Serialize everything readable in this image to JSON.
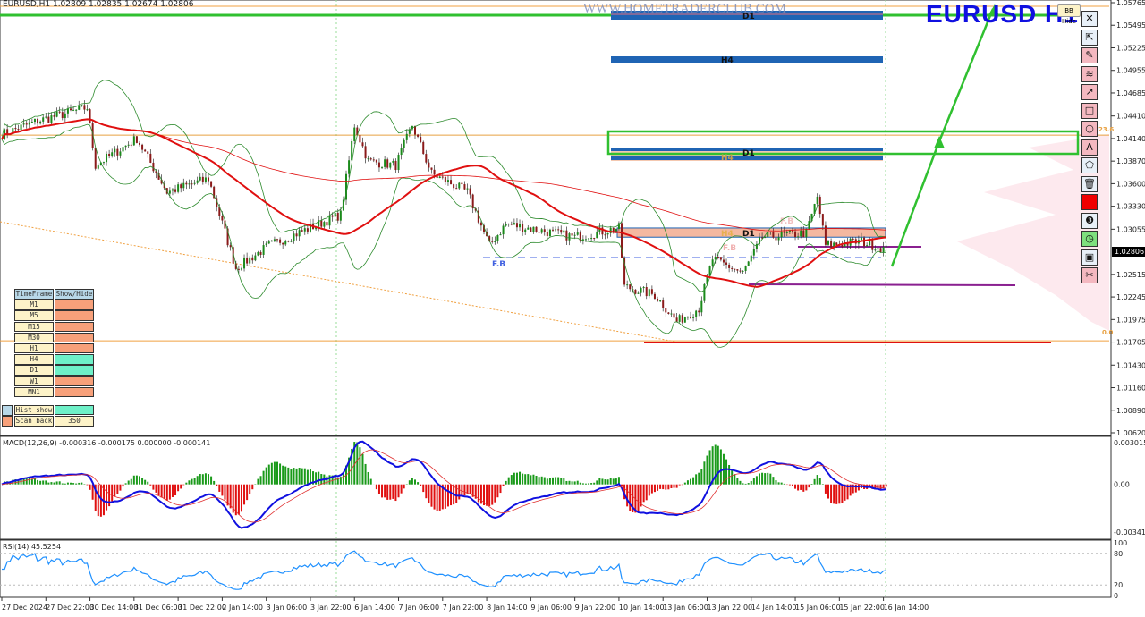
{
  "header": {
    "symbol_info": "EURUSD,H1  1.02809 1.02835 1.02674 1.02806",
    "title": "EURUSD  H1",
    "watermark": "WWW.HOMETRADERCLUB.COM",
    "bb_hide": "BB Hide",
    "current_price": "1.02806"
  },
  "toolbar": [
    {
      "icon": "close-icon",
      "glyph": "✕"
    },
    {
      "icon": "cursor-icon",
      "glyph": "⇱"
    },
    {
      "icon": "pencil-icon",
      "glyph": "✎"
    },
    {
      "icon": "wave-icon",
      "glyph": "≋"
    },
    {
      "icon": "arrow-icon",
      "glyph": "↗"
    },
    {
      "icon": "rectangle-icon",
      "glyph": "□"
    },
    {
      "icon": "circle-icon",
      "glyph": "○"
    },
    {
      "icon": "text-icon",
      "glyph": "A"
    },
    {
      "icon": "fill-icon",
      "glyph": "⬠"
    },
    {
      "icon": "trash-icon",
      "glyph": "🗑"
    },
    {
      "icon": "color-icon",
      "glyph": ""
    },
    {
      "icon": "number-icon",
      "glyph": "❸"
    },
    {
      "icon": "clock-icon",
      "glyph": "◷"
    },
    {
      "icon": "save-icon",
      "glyph": "▣"
    },
    {
      "icon": "scissors-icon",
      "glyph": "✂"
    }
  ],
  "colors": {
    "accent": "#1010e0",
    "bull": "#1a8a1a",
    "bear": "#8b1a1a",
    "ma": "#e01010",
    "bb": "#2e8b2e",
    "zone": "#f4b8a0",
    "zone_border": "#1f64b4"
  },
  "timeframe_table": {
    "headers": [
      "TimeFrame",
      "Show/Hide"
    ],
    "rows": [
      {
        "tf": "M1",
        "on": false
      },
      {
        "tf": "M5",
        "on": false
      },
      {
        "tf": "M15",
        "on": false
      },
      {
        "tf": "M30",
        "on": false
      },
      {
        "tf": "H1",
        "on": false
      },
      {
        "tf": "H4",
        "on": true
      },
      {
        "tf": "D1",
        "on": true
      },
      {
        "tf": "W1",
        "on": false
      },
      {
        "tf": "MN1",
        "on": false
      }
    ],
    "hist_show": "Hist show",
    "scan_back": "Scan back",
    "scan_back_value": "350"
  },
  "zone_labels": {
    "d1_top": "D1",
    "h4_top": "H4",
    "d1_mid": "D1",
    "h4_mid": "H4",
    "d1_low": "D1",
    "h4_low": "H4",
    "fb1": "F.B",
    "fb2": "F.B",
    "fb3": "F.B",
    "fib_236": "23.6",
    "fib_0": "0.0"
  },
  "chart_data": {
    "type": "candlestick",
    "symbol": "EURUSD",
    "timeframe": "H1",
    "y_ticks": [
      "1.05765",
      "1.05495",
      "1.05225",
      "1.04955",
      "1.04685",
      "1.04410",
      "1.04140",
      "1.03870",
      "1.03600",
      "1.03330",
      "1.03055",
      "1.02515",
      "1.02245",
      "1.01975",
      "1.01705",
      "1.01430",
      "1.01160",
      "1.00890",
      "1.00620"
    ],
    "ylim": [
      1.0062,
      1.05765
    ],
    "x_ticks": [
      "27 Dec 2024",
      "27 Dec 22:00",
      "30 Dec 14:00",
      "31 Dec 06:00",
      "31 Dec 22:00",
      "2 Jan 14:00",
      "3 Jan 06:00",
      "3 Jan 22:00",
      "6 Jan 14:00",
      "7 Jan 06:00",
      "7 Jan 22:00",
      "8 Jan 14:00",
      "9 Jan 06:00",
      "9 Jan 22:00",
      "10 Jan 14:00",
      "13 Jan 06:00",
      "13 Jan 22:00",
      "14 Jan 14:00",
      "15 Jan 06:00",
      "15 Jan 22:00",
      "16 Jan 14:00"
    ],
    "bars_per_tick": 16,
    "close_path": [
      [
        0,
        1.0419
      ],
      [
        13,
        1.0435
      ],
      [
        31,
        1.0451
      ],
      [
        34,
        1.0382
      ],
      [
        49,
        1.0414
      ],
      [
        60,
        1.035
      ],
      [
        75,
        1.0366
      ],
      [
        85,
        1.0259
      ],
      [
        97,
        1.0286
      ],
      [
        123,
        1.0323
      ],
      [
        128,
        1.043
      ],
      [
        133,
        1.0387
      ],
      [
        143,
        1.0382
      ],
      [
        149,
        1.043
      ],
      [
        156,
        1.0372
      ],
      [
        169,
        1.035
      ],
      [
        177,
        1.0286
      ],
      [
        183,
        1.0312
      ],
      [
        208,
        1.0296
      ],
      [
        224,
        1.0307
      ],
      [
        226,
        1.0237
      ],
      [
        237,
        1.0227
      ],
      [
        245,
        1.0195
      ],
      [
        253,
        1.0211
      ],
      [
        258,
        1.027
      ],
      [
        269,
        1.0253
      ],
      [
        276,
        1.0296
      ],
      [
        292,
        1.0301
      ],
      [
        296,
        1.0344
      ],
      [
        299,
        1.0286
      ],
      [
        312,
        1.0291
      ],
      [
        321,
        1.0281
      ]
    ],
    "levels": {
      "green_zone": [
        1.0391,
        1.0418
      ],
      "d1_top": 1.0566,
      "h4_top": 1.0509,
      "zone_mid": [
        1.0296,
        1.0307
      ],
      "fib_236": 1.0418,
      "fib_0": 1.0172,
      "red_support": 1.017
    },
    "macd": {
      "label": "MACD(12,26,9) -0.000316 -0.000175 0.000000 -0.000141",
      "ylim": [
        -0.003416,
        0.003015
      ],
      "ticks": [
        "0.003015",
        "0.00",
        "-0.003416"
      ]
    },
    "rsi": {
      "label": "RSI(14) 45.5254",
      "ylim": [
        0,
        100
      ],
      "ticks": [
        "100",
        "80",
        "20",
        "0"
      ]
    }
  }
}
